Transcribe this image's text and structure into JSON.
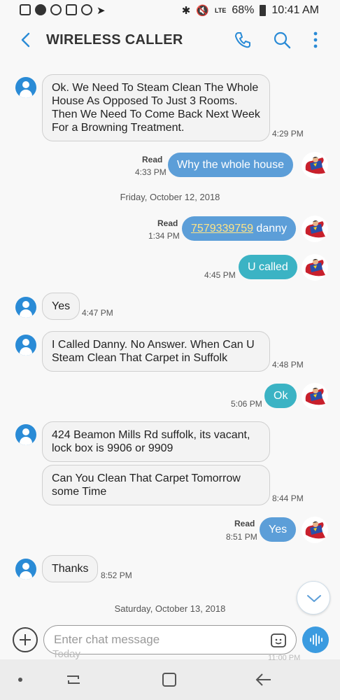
{
  "status": {
    "battery": "68%",
    "time": "10:41 AM",
    "signal": "LTE"
  },
  "header": {
    "title": "WIRELESS CALLER"
  },
  "messages": {
    "m1": {
      "text": "Ok. We Need To Steam Clean The Whole House As Opposed To Just 3 Rooms. Then We Need To Come Back Next Week For a Browning Treatment.",
      "time": "4:29 PM"
    },
    "m2": {
      "read": "Read",
      "time": "4:33 PM",
      "text": "Why the whole house"
    },
    "date1": "Friday, October 12, 2018",
    "m3": {
      "read": "Read",
      "time": "1:34 PM",
      "phone": "7579339759",
      "text": " danny"
    },
    "m4": {
      "time": "4:45 PM",
      "text": "U called"
    },
    "m5": {
      "text": "Yes",
      "time": "4:47 PM"
    },
    "m6": {
      "text": "I Called Danny. No Answer. When Can U Steam Clean That Carpet in Suffolk",
      "time": "4:48 PM"
    },
    "m7": {
      "time": "5:06 PM",
      "text": "Ok"
    },
    "m8": {
      "text": "424 Beamon Mills Rd suffolk, its vacant, lock box is 9906 or 9909"
    },
    "m9": {
      "text": "Can You Clean That Carpet Tomorrow some Time",
      "time": "8:44 PM"
    },
    "m10": {
      "read": "Read",
      "time": "8:51 PM",
      "text": "Yes"
    },
    "m11": {
      "text": "Thanks",
      "time": "8:52 PM"
    },
    "date2": "Saturday, October 13, 2018",
    "ghost_text": "Today",
    "ghost_time": "11:00 PM"
  },
  "compose": {
    "placeholder": "Enter chat message"
  },
  "colors": {
    "outgoing_blue": "#5c9ed8",
    "outgoing_teal": "#3bb3c4",
    "avatar_blue": "#2a8bd6",
    "accent": "#3b9be0"
  }
}
